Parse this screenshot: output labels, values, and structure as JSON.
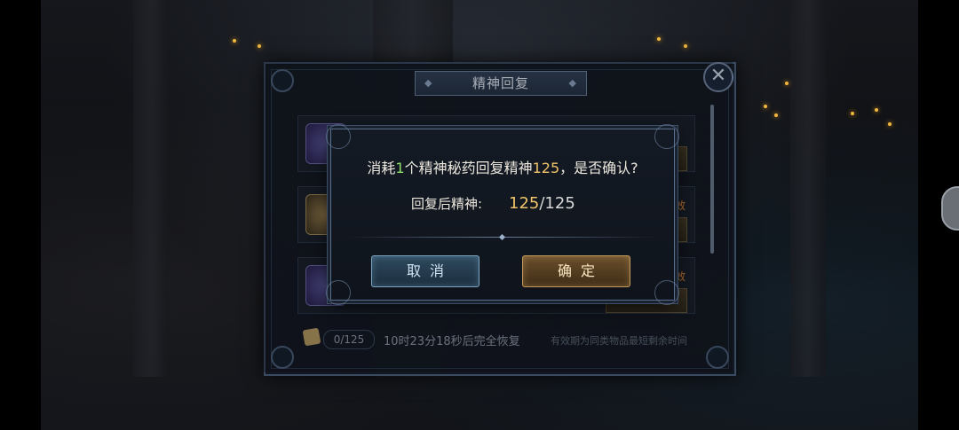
{
  "panel": {
    "title": "精神回复",
    "close_label": "✕",
    "footer": {
      "count": "0/125",
      "timer": "10时23分18秒后完全恢复",
      "note": "有效期为同类物品最短剩余时间"
    },
    "rows": [
      {
        "fail": ""
      },
      {
        "fail": "失效"
      },
      {
        "fail": "失效"
      }
    ]
  },
  "dialog": {
    "msg_prefix": "消耗",
    "msg_count": "1",
    "msg_middle": "个精神秘药回复精神",
    "msg_amount": "125",
    "msg_suffix": "，是否确认?",
    "restore_label": "回复后精神:",
    "restore_current": "125",
    "restore_max": "/125",
    "cancel_label": "取消",
    "confirm_label": "确定"
  },
  "colors": {
    "highlight_green": "#8fe06b",
    "highlight_gold": "#f0c46a",
    "cancel_button": "#2f4a5e",
    "confirm_button": "#6a4f2c"
  }
}
